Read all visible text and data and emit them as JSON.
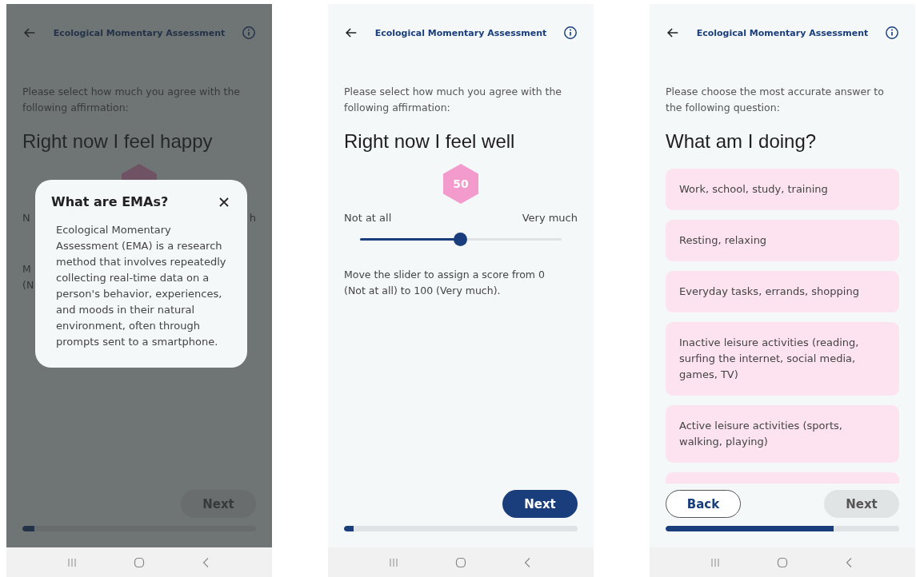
{
  "screens": [
    {
      "kind": "slider",
      "dimmed": true,
      "header": {
        "title": "Ecological Momentary Assessment"
      },
      "instruction": "Please select how much you agree with the following affirmation:",
      "question": "Right now I feel happy",
      "slider": {
        "label_left": "N",
        "label_right": "h"
      },
      "help_lines": [
        "M",
        "(N"
      ],
      "buttons": [
        {
          "kind": "primary",
          "label": "Next",
          "disabled": true
        }
      ],
      "progress": {
        "level": 0.05
      },
      "dialog": {
        "title": "What are EMAs?",
        "body": "Ecological Momentary Assessment (EMA) is a research method that involves repeatedly collecting real-time data on a person's behavior, experiences, and moods in their natural environment, often through prompts sent to a smartphone."
      }
    },
    {
      "kind": "slider",
      "header": {
        "title": "Ecological Momentary Assessment"
      },
      "instruction": "Please select how much you agree with the following affirmation:",
      "question": "Right now I feel well",
      "score": "50",
      "slider": {
        "label_left": "Not at all",
        "label_right": "Very much",
        "level": 0.5
      },
      "help_lines": [
        "Move the slider to assign a score from 0",
        "(Not at all) to 100 (Very much)."
      ],
      "buttons": [
        {
          "kind": "primary",
          "label": "Next",
          "disabled": false
        }
      ],
      "progress": {
        "level": 0.04
      }
    },
    {
      "kind": "choice",
      "header": {
        "title": "Ecological Momentary Assessment"
      },
      "instruction": "Please choose the most accurate answer to the following question:",
      "question": "What am I doing?",
      "options": [
        "Work, school, study, training",
        "Resting, relaxing",
        "Everyday tasks, errands, shopping",
        "Inactive leisure activities (reading, surfing the internet, social media, games, TV)",
        "Active leisure activities (sports, walking, playing)"
      ],
      "more_options_clipped": true,
      "buttons": [
        {
          "kind": "outline",
          "label": "Back",
          "disabled": false
        },
        {
          "kind": "primary",
          "label": "Next",
          "disabled": true
        }
      ],
      "progress": {
        "level": 0.72
      }
    }
  ]
}
